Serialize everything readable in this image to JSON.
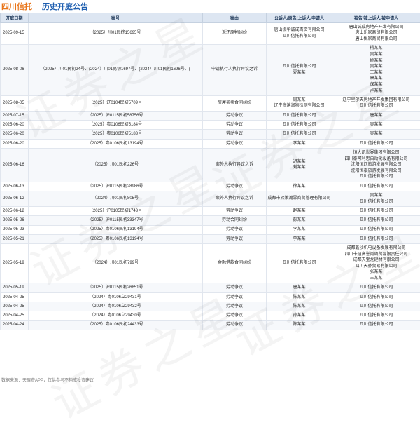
{
  "header": {
    "company": "四川信托",
    "title": "历史开庭公告"
  },
  "columns": [
    "开庭日期",
    "案号",
    "案由",
    "公诉人/原告/上诉人/申请人",
    "被告/被上诉人/被申请人"
  ],
  "rows": [
    {
      "date": "2025-09-15",
      "case": "（2025）川01民终15695号",
      "cause": "返还原物纠纷",
      "plaintiff": [
        "唐山振华诚成百货有限公司",
        "四川信托有限公司"
      ],
      "defendant": [
        "唐山诚成房地产开发有限公司",
        "唐山乐家商贸有限公司",
        "唐山悦家商贸有限公司"
      ]
    },
    {
      "date": "2025-08-06",
      "case": "（2025）川01民初24号、(2024）川01民初1697号、(2024）川01民初1696号、(",
      "cause": "申请执行人执行异议之诉",
      "plaintiff": [
        "四川信托有限公司",
        "夏某某"
      ],
      "defendant": [
        "杨某某",
        "吴某某",
        "姚某某",
        "吴某某",
        "王某某",
        "康某某",
        "保某某",
        "卢某某"
      ]
    },
    {
      "date": "2025-08-05",
      "case": "（2025）辽0104民初5709号",
      "cause": "房屋买卖合同纠纷",
      "plaintiff": [
        "周某某",
        "辽宁海滨润物检测有限公司"
      ],
      "defendant": [
        "辽宁星尔夫房地产开发集团有限公司",
        "四川信托有限公司"
      ]
    },
    {
      "date": "2025-07-15",
      "case": "（2025）沪0115民初58756号",
      "cause": "劳动争议",
      "plaintiff": [
        "四川信托有限公司"
      ],
      "defendant": [
        "唐某某"
      ]
    },
    {
      "date": "2025-06-20",
      "case": "（2025）粤0106民初5184号",
      "cause": "劳动争议",
      "plaintiff": [
        "四川信托有限公司"
      ],
      "defendant": [
        "吴某某"
      ]
    },
    {
      "date": "2025-06-20",
      "case": "（2025）粤0106民初5183号",
      "cause": "劳动争议",
      "plaintiff": [
        "四川信托有限公司"
      ],
      "defendant": [
        "吴某某"
      ]
    },
    {
      "date": "2025-06-20",
      "case": "（2025）粤0106民初13194号",
      "cause": "劳动争议",
      "plaintiff": [
        "李某某"
      ],
      "defendant": [
        "四川信托有限公司"
      ]
    },
    {
      "date": "2025-06-16",
      "case": "（2025）川01民初226号",
      "cause": "案外人执行异议之诉",
      "plaintiff": [
        "迟某某",
        "刘某某"
      ],
      "defendant": [
        "恒大凯世界集团有限公司",
        "四川泰可利思自动化设备有限公司",
        "沈阳恒辽旅游发展有限公司",
        "沈阳恒泰旅游发展有限公司",
        "四川信托有限公司"
      ]
    },
    {
      "date": "2025-06-13",
      "case": "（2025）沪0115民初28986号",
      "cause": "劳动争议",
      "plaintiff": [
        "徐某某"
      ],
      "defendant": [
        "四川信托有限公司"
      ]
    },
    {
      "date": "2025-06-12",
      "case": "（2024）川01民初805号",
      "cause": "案外人执行异议之诉",
      "plaintiff": [
        "成都市熙策瀚霖商贸管理有限公司"
      ],
      "defendant": [
        "吴某某",
        "四川信托有限公司"
      ]
    },
    {
      "date": "2025-06-12",
      "case": "（2025）沪0105民初1743号",
      "cause": "劳动争议",
      "plaintiff": [
        "赵某某"
      ],
      "defendant": [
        "四川信托有限公司"
      ]
    },
    {
      "date": "2025-05-26",
      "case": "（2025）沪0115民初33347号",
      "cause": "劳动合同纠纷",
      "plaintiff": [
        "彭某某"
      ],
      "defendant": [
        "四川信托有限公司"
      ]
    },
    {
      "date": "2025-05-23",
      "case": "（2025）粤0106民初13194号",
      "cause": "劳动争议",
      "plaintiff": [
        "李某某"
      ],
      "defendant": [
        "四川信托有限公司"
      ]
    },
    {
      "date": "2025-05-21",
      "case": "（2025）粤0106民初13194号",
      "cause": "劳动争议",
      "plaintiff": [
        "李某某"
      ],
      "defendant": [
        "四川信托有限公司"
      ]
    },
    {
      "date": "2025-05-19",
      "case": "（2024）川01民初799号",
      "cause": "金融借款合同纠纷",
      "plaintiff": [
        "四川信托有限公司"
      ],
      "defendant": [
        "成都鑫沙机电设备发展有限公司",
        "四川卡迪高誉尚周贸易限责任公司",
        "成都天宝龙建材有限公司",
        "四川天骅贸易有限公司",
        "张某某",
        "王某某"
      ]
    },
    {
      "date": "2025-05-19",
      "case": "（2025）沪0115民初26851号",
      "cause": "劳动争议",
      "plaintiff": [
        "唐某某"
      ],
      "defendant": [
        "四川信托有限公司"
      ]
    },
    {
      "date": "2025-04-25",
      "case": "（2024）粤0106立29431号",
      "cause": "劳动争议",
      "plaintiff": [
        "陈某某"
      ],
      "defendant": [
        "四川信托有限公司"
      ]
    },
    {
      "date": "2025-04-25",
      "case": "（2024）粤0106立29432号",
      "cause": "劳动争议",
      "plaintiff": [
        "陈某某"
      ],
      "defendant": [
        "四川信托有限公司"
      ]
    },
    {
      "date": "2025-04-25",
      "case": "（2024）粤0106立29430号",
      "cause": "劳动争议",
      "plaintiff": [
        "孙某某"
      ],
      "defendant": [
        "四川信托有限公司"
      ]
    },
    {
      "date": "2025-04-24",
      "case": "（2025）粤0106民初24433号",
      "cause": "劳动争议",
      "plaintiff": [
        "陈某某"
      ],
      "defendant": [
        "四川信托有限公司"
      ]
    }
  ],
  "footer": "数据来源：天眼查APP，仅供参考不构成投资建议",
  "watermark": "证券之星"
}
